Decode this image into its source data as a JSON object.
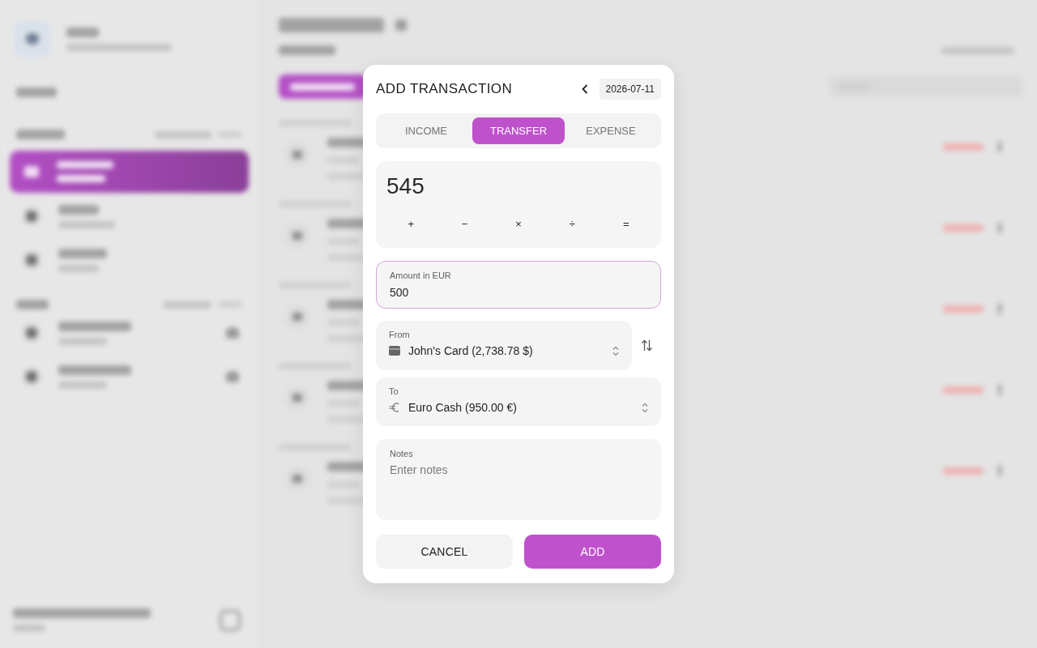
{
  "dialog": {
    "title": "ADD TRANSACTION",
    "date": "2026-07-11",
    "tabs": [
      {
        "label": "INCOME",
        "selected": false
      },
      {
        "label": "TRANSFER",
        "selected": true
      },
      {
        "label": "EXPENSE",
        "selected": false
      }
    ],
    "calculator": {
      "display": "545",
      "operators": [
        "+",
        "−",
        "×",
        "÷",
        "="
      ]
    },
    "amount_field": {
      "label": "Amount in EUR",
      "value": "500",
      "focused": true
    },
    "from_field": {
      "label": "From",
      "value": "John's Card (2,738.78 $)"
    },
    "to_field": {
      "label": "To",
      "value": "Euro Cash (950.00 €)"
    },
    "notes_field": {
      "label": "Notes",
      "placeholder": "Enter notes"
    },
    "buttons": [
      {
        "label": "CANCEL",
        "kind": "secondary"
      },
      {
        "label": "ADD",
        "kind": "primary"
      }
    ]
  }
}
